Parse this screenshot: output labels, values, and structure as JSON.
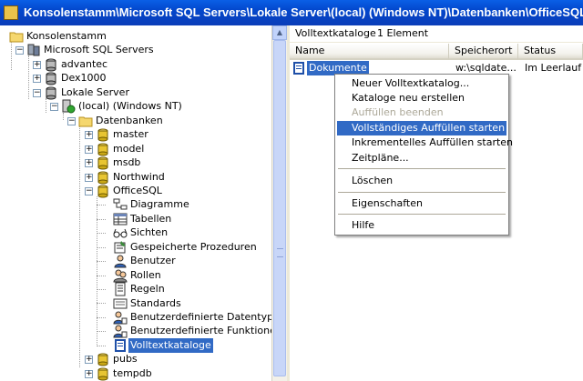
{
  "window": {
    "title": "Konsolenstamm\\Microsoft SQL Servers\\Lokale Server\\(local) (Windows NT)\\Datenbanken\\OfficeSQL\\Volltextkataloge"
  },
  "tree": {
    "items": [
      {
        "label": "Konsolenstamm",
        "icon": "folder-icon",
        "expander": "",
        "selected": false
      },
      {
        "label": "Microsoft SQL Servers",
        "icon": "sql-servers-icon",
        "expander": "−",
        "selected": false
      },
      {
        "label": "advantec",
        "icon": "server-group-icon",
        "expander": "+",
        "selected": false
      },
      {
        "label": "Dex1000",
        "icon": "server-group-icon",
        "expander": "+",
        "selected": false
      },
      {
        "label": "Lokale Server",
        "icon": "server-group-icon",
        "expander": "−",
        "selected": false
      },
      {
        "label": "(local) (Windows NT)",
        "icon": "server-running-icon",
        "expander": "−",
        "selected": false
      },
      {
        "label": "Datenbanken",
        "icon": "folder-icon",
        "expander": "−",
        "selected": false
      },
      {
        "label": "master",
        "icon": "database-icon",
        "expander": "+",
        "selected": false
      },
      {
        "label": "model",
        "icon": "database-icon",
        "expander": "+",
        "selected": false
      },
      {
        "label": "msdb",
        "icon": "database-icon",
        "expander": "+",
        "selected": false
      },
      {
        "label": "Northwind",
        "icon": "database-icon",
        "expander": "+",
        "selected": false
      },
      {
        "label": "OfficeSQL",
        "icon": "database-icon",
        "expander": "−",
        "selected": false
      },
      {
        "label": "Diagramme",
        "icon": "diagram-icon",
        "expander": "",
        "selected": false
      },
      {
        "label": "Tabellen",
        "icon": "table-icon",
        "expander": "",
        "selected": false
      },
      {
        "label": "Sichten",
        "icon": "glasses-icon",
        "expander": "",
        "selected": false
      },
      {
        "label": "Gespeicherte Prozeduren",
        "icon": "stored-procedure-icon",
        "expander": "",
        "selected": false
      },
      {
        "label": "Benutzer",
        "icon": "user-icon",
        "expander": "",
        "selected": false
      },
      {
        "label": "Rollen",
        "icon": "roles-icon",
        "expander": "",
        "selected": false
      },
      {
        "label": "Regeln",
        "icon": "rules-icon",
        "expander": "",
        "selected": false
      },
      {
        "label": "Standards",
        "icon": "defaults-icon",
        "expander": "",
        "selected": false
      },
      {
        "label": "Benutzerdefinierte Datentypen",
        "icon": "user-datatype-icon",
        "expander": "",
        "selected": false
      },
      {
        "label": "Benutzerdefinierte Funktionen",
        "icon": "user-function-icon",
        "expander": "",
        "selected": false
      },
      {
        "label": "Volltextkataloge",
        "icon": "fulltext-catalog-icon",
        "expander": "",
        "selected": true
      },
      {
        "label": "pubs",
        "icon": "database-icon",
        "expander": "+",
        "selected": false
      },
      {
        "label": "tempdb",
        "icon": "database-icon",
        "expander": "+",
        "selected": false
      }
    ]
  },
  "details": {
    "header_title": "Volltextkataloge",
    "header_count": "1 Element",
    "columns": [
      "Name",
      "Speicherort",
      "Status"
    ],
    "rows": [
      {
        "name": "Dokumente",
        "location": "w:\\sqldate...",
        "status": "Im Leerlauf"
      }
    ]
  },
  "context_menu": {
    "items": [
      {
        "label": "Neuer Volltextkatalog...",
        "state": "normal"
      },
      {
        "label": "Kataloge neu erstellen",
        "state": "normal"
      },
      {
        "label": "Auffüllen beenden",
        "state": "disabled"
      },
      {
        "label": "Vollständiges Auffüllen starten",
        "state": "highlighted"
      },
      {
        "label": "Inkrementelles Auffüllen starten",
        "state": "normal"
      },
      {
        "label": "Zeitpläne...",
        "state": "normal"
      },
      {
        "label": "Löschen",
        "state": "normal"
      },
      {
        "label": "Eigenschaften",
        "state": "normal"
      },
      {
        "label": "Hilfe",
        "state": "normal"
      }
    ]
  },
  "colors": {
    "titlebar": "#0347cc",
    "selection": "#316ac5",
    "disabled": "#aca899"
  }
}
